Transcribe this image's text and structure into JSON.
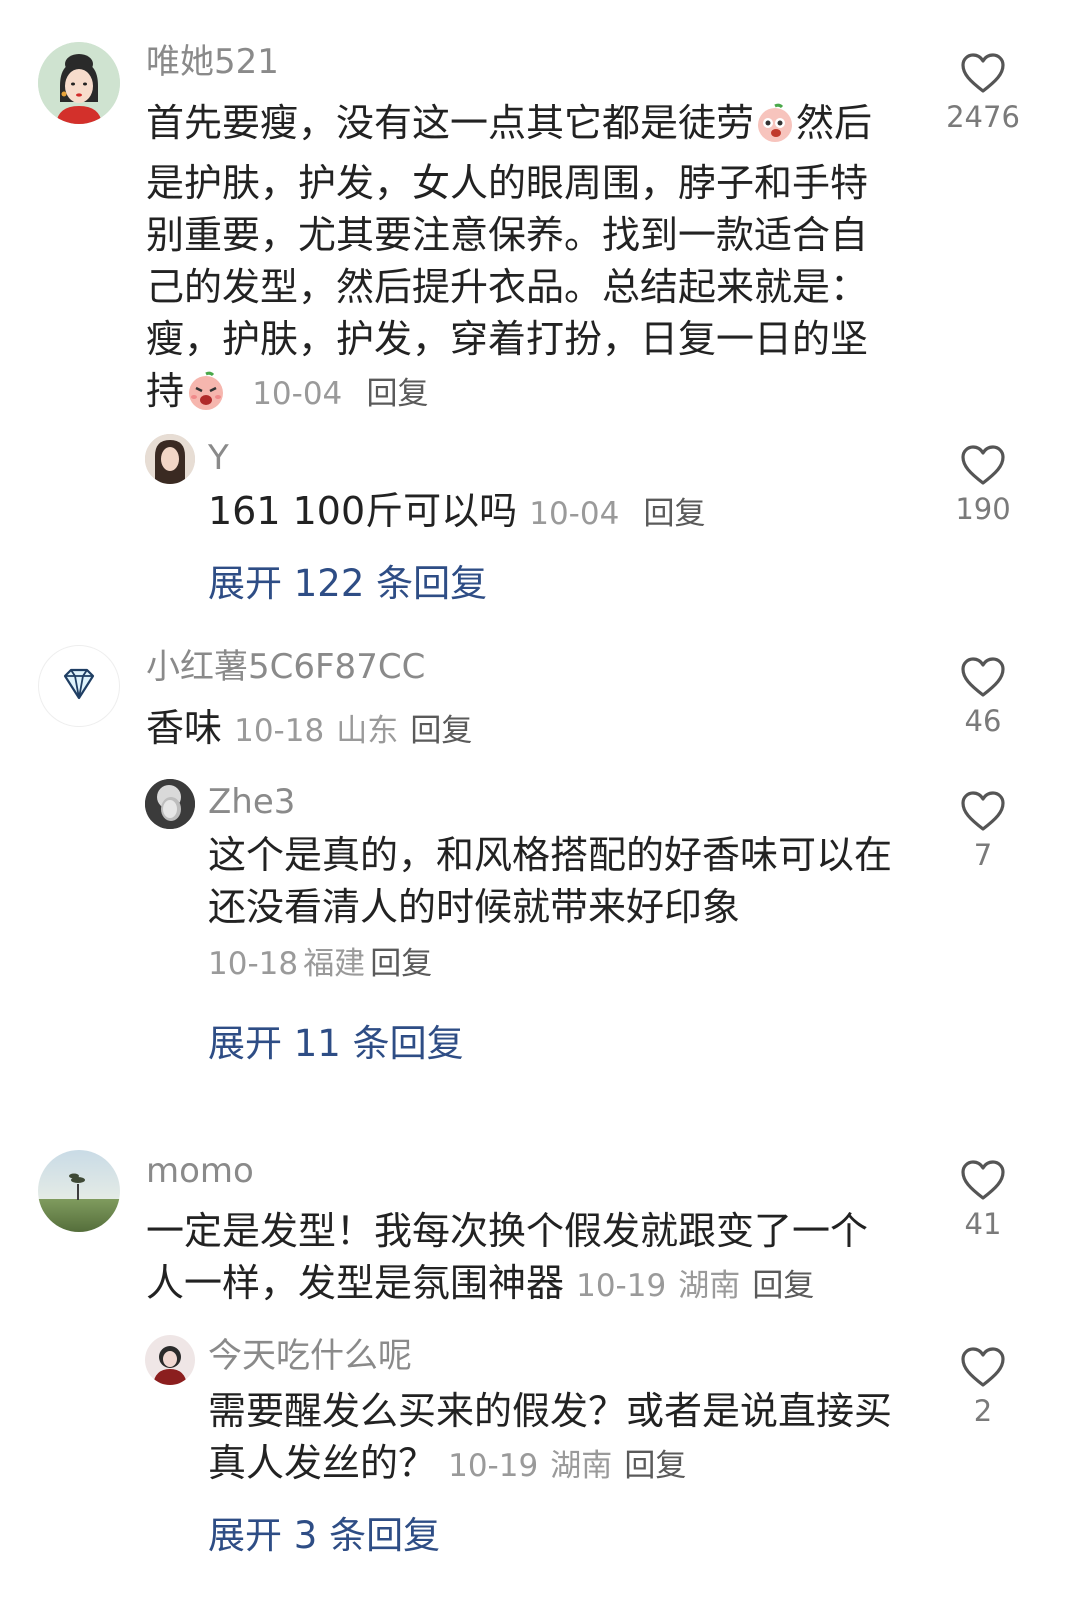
{
  "comments": [
    {
      "username": "唯她521",
      "text_before_emoji": "首先要瘦，没有这一点其它都是徒劳",
      "emoji1": "peach-face-emoji",
      "text_after_emoji": "然后是护肤，护发，女人的眼周围，脖子和手特别重要，尤其要注意保养。找到一款适合自己的发型，然后提升衣品。总结起来就是：瘦，护肤，护发，穿着打扮，日复一日的坚持",
      "emoji2": "shocked-peach-emoji",
      "date": "10-04",
      "reply_label": "回复",
      "likes": "2476",
      "reply": {
        "username": "Y",
        "text": "161 100斤可以吗",
        "date": "10-04",
        "reply_label": "回复",
        "likes": "190"
      },
      "expand_label": "展开 122 条回复"
    },
    {
      "username": "小红薯5C6F87CC",
      "text": "香味",
      "date": "10-18",
      "location": "山东",
      "reply_label": "回复",
      "likes": "46",
      "reply": {
        "username": "Zhe3",
        "text": "这个是真的，和风格搭配的好香味可以在还没看清人的时候就带来好印象",
        "date": "10-18",
        "location": "福建",
        "reply_label": "回复",
        "likes": "7"
      },
      "expand_label": "展开 11 条回复"
    },
    {
      "username": "momo",
      "text": "一定是发型！我每次换个假发就跟变了一个人一样，发型是氛围神器",
      "date": "10-19",
      "location": "湖南",
      "reply_label": "回复",
      "likes": "41",
      "reply": {
        "username": "今天吃什么呢",
        "text": "需要醒发么买来的假发？或者是说直接买真人发丝的？",
        "date": "10-19",
        "location": "湖南",
        "reply_label": "回复",
        "likes": "2"
      },
      "expand_label": "展开 3 条回复"
    }
  ],
  "colors": {
    "expand_link": "#2e4d85",
    "meta": "#9a9a9a",
    "username": "#8a8a8a"
  }
}
